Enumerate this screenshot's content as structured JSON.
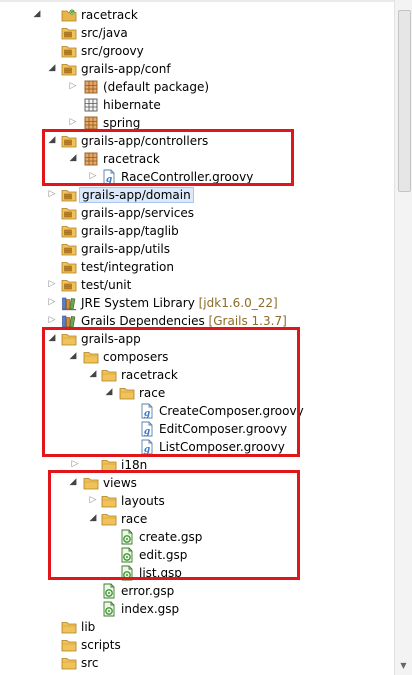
{
  "tree": [
    {
      "label": "racetrack",
      "icon": "project-icon",
      "toggle": "expanded"
    },
    {
      "label": "src/java",
      "icon": "source-folder-icon",
      "toggle": "none"
    },
    {
      "label": "src/groovy",
      "icon": "source-folder-icon",
      "toggle": "none"
    },
    {
      "label": "grails-app/conf",
      "icon": "source-folder-icon",
      "toggle": "expanded"
    },
    {
      "label": "(default package)",
      "icon": "package-icon",
      "toggle": "collapsed"
    },
    {
      "label": "hibernate",
      "icon": "empty-package-icon",
      "toggle": "none"
    },
    {
      "label": "spring",
      "icon": "package-icon",
      "toggle": "collapsed"
    },
    {
      "label": "grails-app/controllers",
      "icon": "source-folder-icon",
      "toggle": "expanded"
    },
    {
      "label": "racetrack",
      "icon": "package-icon",
      "toggle": "expanded"
    },
    {
      "label": "RaceController.groovy",
      "icon": "groovy-file-icon",
      "toggle": "collapsed"
    },
    {
      "label": "grails-app/domain",
      "icon": "source-folder-icon",
      "toggle": "collapsed",
      "selected": true
    },
    {
      "label": "grails-app/services",
      "icon": "source-folder-icon",
      "toggle": "none"
    },
    {
      "label": "grails-app/taglib",
      "icon": "source-folder-icon",
      "toggle": "none"
    },
    {
      "label": "grails-app/utils",
      "icon": "source-folder-icon",
      "toggle": "none"
    },
    {
      "label": "test/integration",
      "icon": "source-folder-icon",
      "toggle": "none"
    },
    {
      "label": "test/unit",
      "icon": "source-folder-icon",
      "toggle": "collapsed"
    },
    {
      "label": "JRE System Library",
      "decoration": "[jdk1.6.0_22]",
      "icon": "library-icon",
      "toggle": "collapsed"
    },
    {
      "label": "Grails Dependencies",
      "decoration": "[Grails 1.3.7]",
      "icon": "library-icon",
      "toggle": "collapsed"
    },
    {
      "label": "grails-app",
      "icon": "folder-icon",
      "toggle": "expanded"
    },
    {
      "label": "composers",
      "icon": "folder-icon",
      "toggle": "expanded"
    },
    {
      "label": "racetrack",
      "icon": "folder-icon",
      "toggle": "expanded"
    },
    {
      "label": "race",
      "icon": "folder-icon",
      "toggle": "expanded"
    },
    {
      "label": "CreateComposer.groovy",
      "icon": "groovy-file-icon",
      "toggle": "none"
    },
    {
      "label": "EditComposer.groovy",
      "icon": "groovy-file-icon",
      "toggle": "none"
    },
    {
      "label": "ListComposer.groovy",
      "icon": "groovy-file-icon",
      "toggle": "none"
    },
    {
      "label": "i18n",
      "icon": "folder-icon",
      "toggle": "collapsed"
    },
    {
      "label": "views",
      "icon": "folder-icon",
      "toggle": "expanded"
    },
    {
      "label": "layouts",
      "icon": "folder-icon",
      "toggle": "collapsed"
    },
    {
      "label": "race",
      "icon": "folder-icon",
      "toggle": "expanded"
    },
    {
      "label": "create.gsp",
      "icon": "gsp-file-icon",
      "toggle": "none"
    },
    {
      "label": "edit.gsp",
      "icon": "gsp-file-icon",
      "toggle": "none"
    },
    {
      "label": "list.gsp",
      "icon": "gsp-file-icon",
      "toggle": "none"
    },
    {
      "label": "error.gsp",
      "icon": "gsp-file-icon",
      "toggle": "none"
    },
    {
      "label": "index.gsp",
      "icon": "gsp-file-icon",
      "toggle": "none"
    },
    {
      "label": "lib",
      "icon": "folder-icon",
      "toggle": "none"
    },
    {
      "label": "scripts",
      "icon": "folder-icon",
      "toggle": "none"
    },
    {
      "label": "src",
      "icon": "folder-icon",
      "toggle": "none"
    }
  ],
  "colors": {
    "highlight_box": "#e0161a",
    "folder": "#e8b54a",
    "package": "#b0702a",
    "groovy": "#3b78c9",
    "gsp": "#3d9b34",
    "decoration": "#8b6c2a",
    "selection": "#dbe9fb"
  }
}
